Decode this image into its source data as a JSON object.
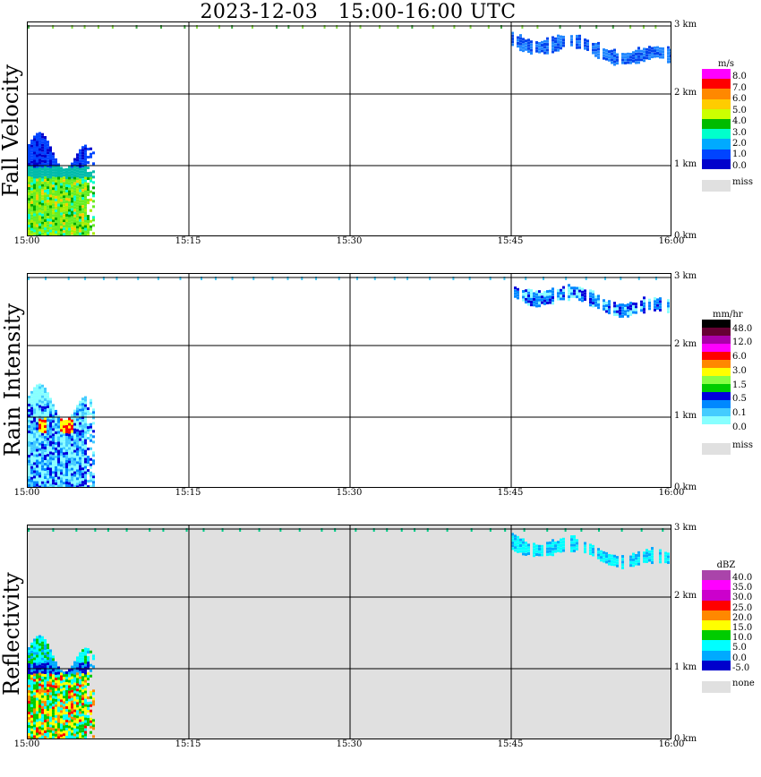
{
  "title": "2023-12-03   15:00-16:00 UTC",
  "x_ticks": [
    "15:00",
    "15:15",
    "15:30",
    "15:45",
    "16:00"
  ],
  "y_ticks": [
    "0 km",
    "1 km",
    "2 km",
    "3 km"
  ],
  "chart_data": [
    {
      "type": "heatmap",
      "title": "Fall Velocity",
      "ylabel": "Fall Velocity",
      "x_range": [
        "15:00",
        "16:00"
      ],
      "y_range_km": [
        0,
        3.0
      ],
      "background": "#ffffff",
      "legend": {
        "unit": "m/s",
        "labels": [
          "8.0",
          "7.0",
          "6.0",
          "5.0",
          "4.0",
          "3.0",
          "2.0",
          "1.0",
          "0.0"
        ],
        "colors": [
          "#ff00ff",
          "#ff0000",
          "#ff8800",
          "#ffcc00",
          "#ccff00",
          "#00bb00",
          "#00ffcc",
          "#00aaff",
          "#0044ff",
          "#0000cc"
        ],
        "miss_label": "miss",
        "miss_color": "#e0e0e0"
      }
    },
    {
      "type": "heatmap",
      "title": "Rain Intensity",
      "ylabel": "Rain Intensity",
      "x_range": [
        "15:00",
        "16:00"
      ],
      "y_range_km": [
        0,
        3.0
      ],
      "background": "#ffffff",
      "legend": {
        "unit": "mm/hr",
        "labels": [
          "48.0",
          "12.0",
          "6.0",
          "3.0",
          "1.5",
          "0.5",
          "0.1",
          "0.0"
        ],
        "colors": [
          "#000000",
          "#660033",
          "#aa00aa",
          "#ff00ff",
          "#ff0000",
          "#ff8800",
          "#ffff00",
          "#88ff44",
          "#00cc00",
          "#0000dd",
          "#0088ff",
          "#44ccff",
          "#88ffff",
          "#ffffff"
        ],
        "miss_label": "miss",
        "miss_color": "#e0e0e0"
      }
    },
    {
      "type": "heatmap",
      "title": "Reflectivity",
      "ylabel": "Reflectivity",
      "x_range": [
        "15:00",
        "16:00"
      ],
      "y_range_km": [
        0,
        3.0
      ],
      "background": "#e0e0e0",
      "legend": {
        "unit": "dBZ",
        "labels": [
          "40.0",
          "35.0",
          "30.0",
          "25.0",
          "20.0",
          "15.0",
          "10.0",
          "5.0",
          "0.0",
          "-5.0"
        ],
        "colors": [
          "#aa44aa",
          "#ff00ff",
          "#cc00cc",
          "#ff0000",
          "#ff8800",
          "#ffff00",
          "#00cc00",
          "#00ffff",
          "#00aaff",
          "#0000cc"
        ],
        "miss_label": "none",
        "miss_color": "#e0e0e0"
      }
    }
  ]
}
